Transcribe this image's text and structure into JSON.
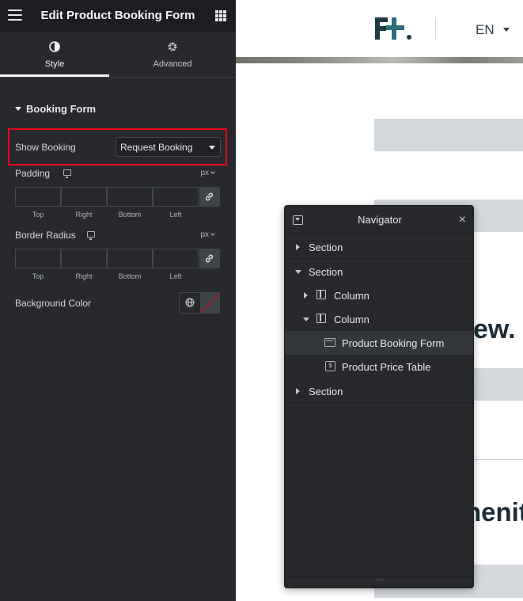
{
  "panel": {
    "title": "Edit Product Booking Form",
    "tabs": [
      {
        "label": "Style",
        "icon": "contrast-icon",
        "active": true
      },
      {
        "label": "Advanced",
        "icon": "gear-icon",
        "active": false
      }
    ],
    "section_title": "Booking Form",
    "show_booking": {
      "label": "Show Booking",
      "value": "Request Booking"
    },
    "padding": {
      "label": "Padding",
      "unit": "px",
      "sides": [
        "Top",
        "Right",
        "Bottom",
        "Left"
      ]
    },
    "border_radius": {
      "label": "Border Radius",
      "unit": "px",
      "sides": [
        "Top",
        "Right",
        "Bottom",
        "Left"
      ]
    },
    "background_color": {
      "label": "Background Color"
    }
  },
  "preview": {
    "logo_text": "F+.",
    "language": "EN",
    "heading_fragment": "ew.",
    "amenities_fragment": "nenit"
  },
  "navigator": {
    "title": "Navigator",
    "close_glyph": "×",
    "items": [
      {
        "label": "Section",
        "level": 0,
        "expanded": false
      },
      {
        "label": "Section",
        "level": 0,
        "expanded": true
      },
      {
        "label": "Column",
        "level": 1,
        "expanded": false
      },
      {
        "label": "Column",
        "level": 1,
        "expanded": true
      },
      {
        "label": "Product Booking Form",
        "level": 2,
        "active": true
      },
      {
        "label": "Product Price Table",
        "level": 2
      },
      {
        "label": "Section",
        "level": 0,
        "expanded": false
      }
    ],
    "footer_glyph": "···"
  },
  "colors": {
    "panel_bg": "#27292d",
    "highlight_border": "#e5081c",
    "brand_teal": "#2b6f7a"
  }
}
